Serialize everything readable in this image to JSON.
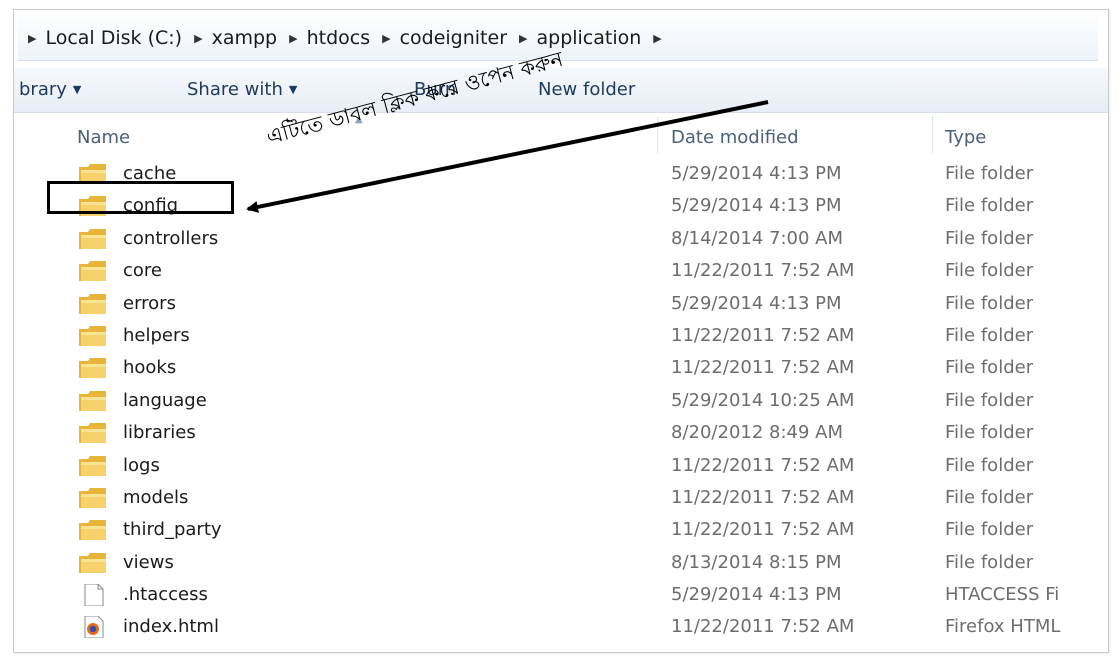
{
  "breadcrumb": [
    "Local Disk (C:)",
    "xampp",
    "htdocs",
    "codeigniter",
    "application"
  ],
  "toolbar": {
    "library_label": "brary",
    "share_label": "Share with",
    "burn_label": "Burn",
    "new_folder_label": "New folder"
  },
  "columns": {
    "name": "Name",
    "date": "Date modified",
    "type": "Type"
  },
  "files": [
    {
      "name": "cache",
      "date": "5/29/2014 4:13 PM",
      "type": "File folder",
      "icon": "folder-icon"
    },
    {
      "name": "config",
      "date": "5/29/2014 4:13 PM",
      "type": "File folder",
      "icon": "folder-icon"
    },
    {
      "name": "controllers",
      "date": "8/14/2014 7:00 AM",
      "type": "File folder",
      "icon": "folder-icon"
    },
    {
      "name": "core",
      "date": "11/22/2011 7:52 AM",
      "type": "File folder",
      "icon": "folder-icon"
    },
    {
      "name": "errors",
      "date": "5/29/2014 4:13 PM",
      "type": "File folder",
      "icon": "folder-icon"
    },
    {
      "name": "helpers",
      "date": "11/22/2011 7:52 AM",
      "type": "File folder",
      "icon": "folder-icon"
    },
    {
      "name": "hooks",
      "date": "11/22/2011 7:52 AM",
      "type": "File folder",
      "icon": "folder-icon"
    },
    {
      "name": "language",
      "date": "5/29/2014 10:25 AM",
      "type": "File folder",
      "icon": "folder-icon"
    },
    {
      "name": "libraries",
      "date": "8/20/2012 8:49 AM",
      "type": "File folder",
      "icon": "folder-icon"
    },
    {
      "name": "logs",
      "date": "11/22/2011 7:52 AM",
      "type": "File folder",
      "icon": "folder-icon"
    },
    {
      "name": "models",
      "date": "11/22/2011 7:52 AM",
      "type": "File folder",
      "icon": "folder-icon"
    },
    {
      "name": "third_party",
      "date": "11/22/2011 7:52 AM",
      "type": "File folder",
      "icon": "folder-icon"
    },
    {
      "name": "views",
      "date": "8/13/2014 8:15 PM",
      "type": "File folder",
      "icon": "folder-icon"
    },
    {
      "name": ".htaccess",
      "date": "5/29/2014 4:13 PM",
      "type": "HTACCESS Fi",
      "icon": "blank-file-icon"
    },
    {
      "name": "index.html",
      "date": "11/22/2011 7:52 AM",
      "type": "Firefox HTML",
      "icon": "firefox-file-icon"
    }
  ],
  "annotation": {
    "text": "এটিতে ডাবল ক্লিক করে ওপেন করুন"
  },
  "colors": {
    "folder": "#f4c94a",
    "toolbar_text": "#1e395b",
    "header_text": "#4c607a"
  }
}
